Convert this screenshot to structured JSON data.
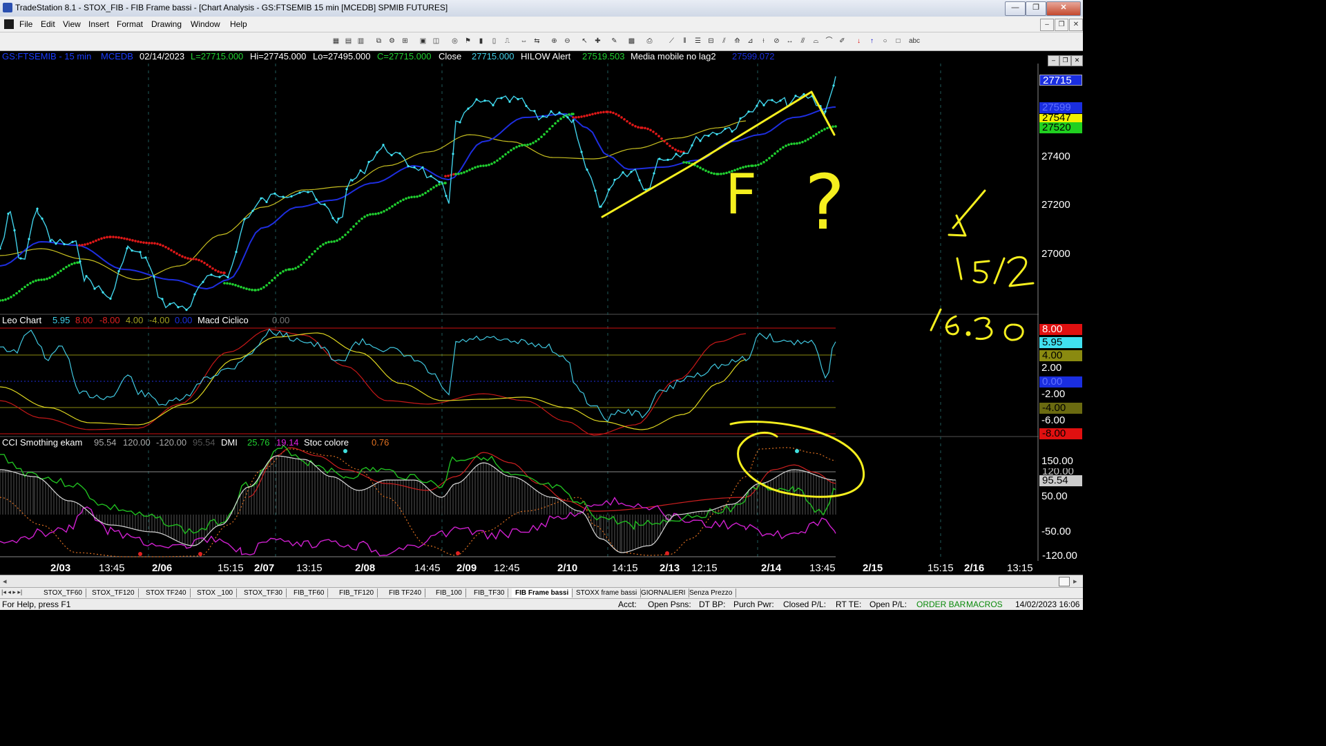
{
  "window": {
    "title": "TradeStation 8.1 - STOX_FIB - FIB Frame bassi - [Chart Analysis - GS:FTSEMIB 15 min [MCEDB] SPMIB FUTURES]",
    "minimize": "—",
    "restore": "❐",
    "close": "✕"
  },
  "menu": [
    "File",
    "Edit",
    "View",
    "Insert",
    "Format",
    "Drawing",
    "Window",
    "Help"
  ],
  "chart_info": {
    "symbol": "GS:FTSEMIB - 15 min",
    "data_name": "MCEDB",
    "date": "02/14/2023",
    "last": "L=27715.000",
    "high": "Hi=27745.000",
    "low": "Lo=27495.000",
    "close": "C=27715.000",
    "close_label": "Close",
    "close_value": "27715.000",
    "hilow_label": "HILOW Alert",
    "hilow_value": "27519.503",
    "ma_label": "Media mobile no lag2",
    "ma_value": "27599.072"
  },
  "price_axis": {
    "labels": [
      "27400",
      "27200",
      "27000"
    ],
    "tags": [
      "27715",
      "27599",
      "27547",
      "27520"
    ]
  },
  "pane2": {
    "name": "Leo Chart",
    "values": [
      "5.95",
      "8.00",
      "-8.00",
      "4.00",
      "-4.00",
      "0.00"
    ],
    "second_name": "Macd Ciclico",
    "second_value": "0.00",
    "axis_labels": [
      "2.00",
      "-2.00",
      "-6.00"
    ],
    "tags": [
      "8.00",
      "5.95",
      "4.00",
      "0.00",
      "-4.00",
      "-8.00"
    ]
  },
  "pane3": {
    "name": "CCI Smothing ekam",
    "values": [
      "95.54",
      "120.00",
      "-120.00",
      "95.54"
    ],
    "dmi_label": "DMI",
    "dmi_values": [
      "25.76",
      "19.14"
    ],
    "stoc_label": "Stoc colore",
    "stoc_value": "0.76",
    "axis_labels": [
      "150.00",
      "50.00",
      "-50.00"
    ],
    "tags": [
      "120.00",
      "95.54",
      "-120.00"
    ]
  },
  "time_axis": [
    {
      "label": "2/03",
      "bold": true
    },
    {
      "label": "13:45",
      "bold": false
    },
    {
      "label": "2/06",
      "bold": true
    },
    {
      "label": "15:15",
      "bold": false
    },
    {
      "label": "2/07",
      "bold": true
    },
    {
      "label": "13:15",
      "bold": false
    },
    {
      "label": "2/08",
      "bold": true
    },
    {
      "label": "14:45",
      "bold": false
    },
    {
      "label": "2/09",
      "bold": true
    },
    {
      "label": "12:45",
      "bold": false
    },
    {
      "label": "2/10",
      "bold": true
    },
    {
      "label": "14:15",
      "bold": false
    },
    {
      "label": "2/13",
      "bold": true
    },
    {
      "label": "12:15",
      "bold": false
    },
    {
      "label": "2/14",
      "bold": true
    },
    {
      "label": "13:45",
      "bold": false
    },
    {
      "label": "2/15",
      "bold": true
    },
    {
      "label": "15:15",
      "bold": false
    },
    {
      "label": "2/16",
      "bold": true
    },
    {
      "label": "13:15",
      "bold": false
    }
  ],
  "annotations": {
    "f_mark": "F",
    "question": "?",
    "date_note": "15/2",
    "time_note": "16.30"
  },
  "tabs": [
    "STOX_TF60",
    "STOX_TF120",
    "STOX TF240",
    "STOX _100",
    "STOX_TF30",
    "FIB_TF60",
    "FIB_TF120",
    "FIB TF240",
    "FIB_100",
    "FIB_TF30",
    "FIB Frame bassi",
    "STOXX frame bassi",
    "GIORNALIERI",
    "Senza Prezzo"
  ],
  "active_tab": "FIB Frame bassi",
  "status": {
    "help": "For Help, press F1",
    "acct": "Acct:",
    "open_psns": "Open Psns:",
    "dt_bp": "DT BP:",
    "purch_pwr": "Purch Pwr:",
    "closed_pl": "Closed P/L:",
    "rt_te": "RT TE:",
    "open_pl": "Open P/L:",
    "order_bar": "ORDER BAR",
    "macros": "MACROS",
    "datetime": "14/02/2023 16:06"
  },
  "colors": {
    "price": "#40d0e8",
    "ma_blue": "#1e2ee0",
    "ma_yellow": "#c8c020",
    "hilow_green": "#20d030",
    "hilow_red": "#e01818",
    "annotation": "#f5ef1e"
  }
}
